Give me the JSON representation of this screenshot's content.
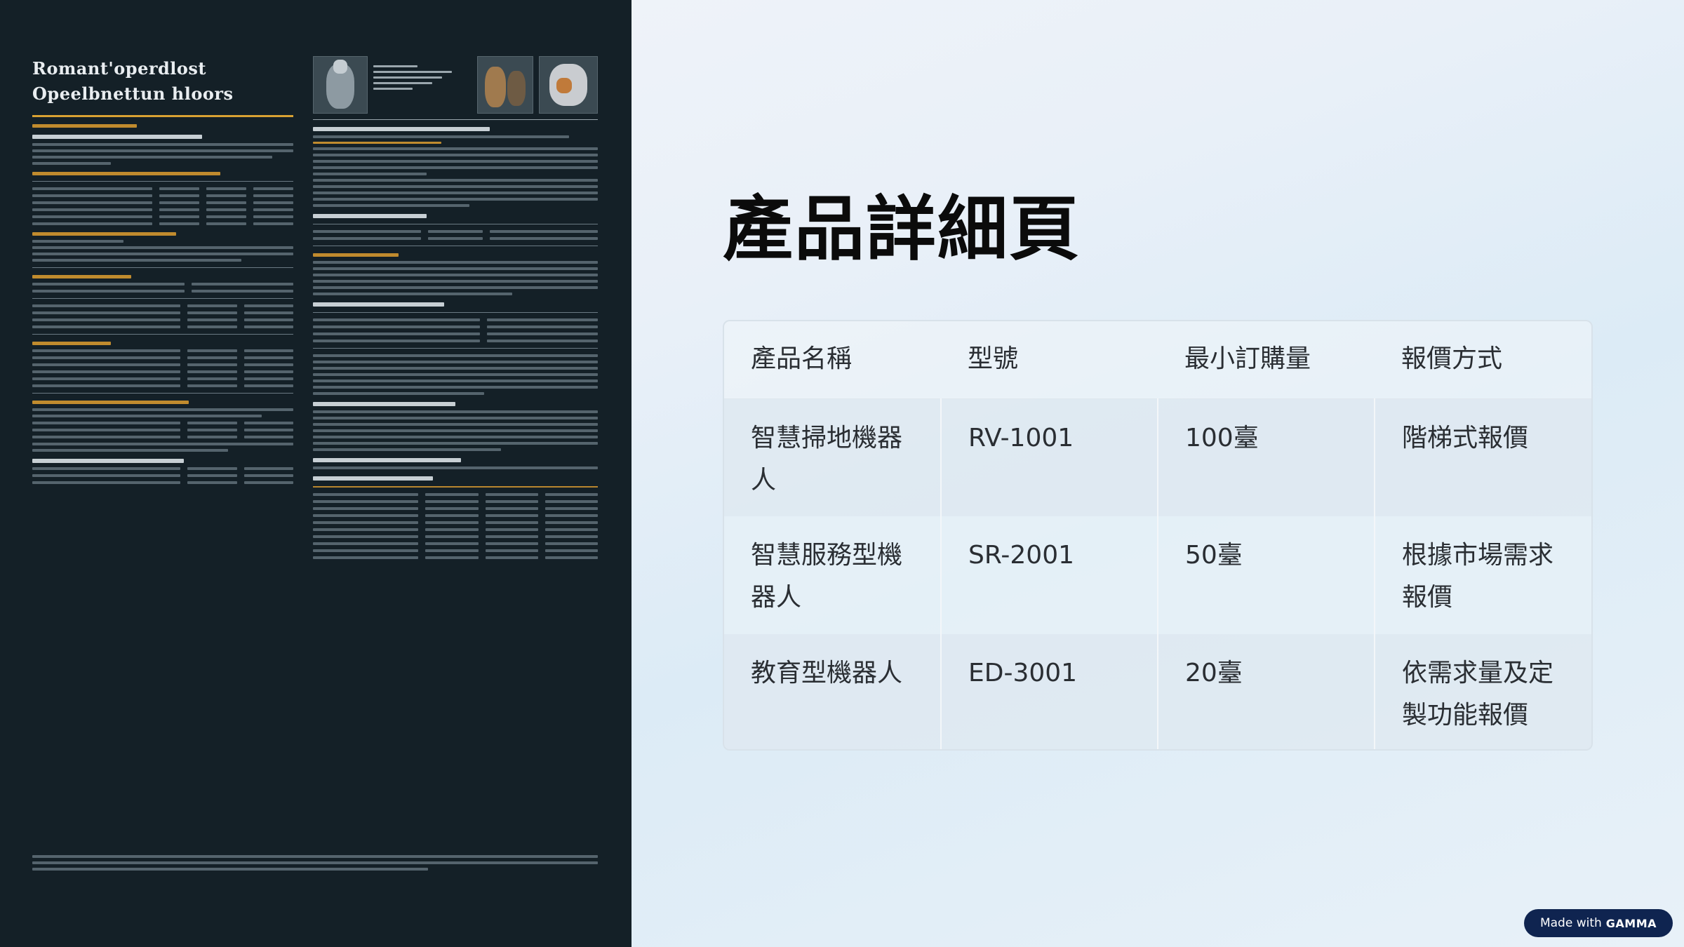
{
  "left_image": {
    "title_line1": "Romant'operdlost",
    "title_line2": "Opeelbnettun hloors"
  },
  "page": {
    "title": "產品詳細頁"
  },
  "table": {
    "headers": [
      "產品名稱",
      "型號",
      "最小訂購量",
      "報價方式"
    ],
    "rows": [
      [
        "智慧掃地機器人",
        "RV-1001",
        "100臺",
        "階梯式報價"
      ],
      [
        "智慧服務型機器人",
        "SR-2001",
        "50臺",
        "根據市場需求報價"
      ],
      [
        "教育型機器人",
        "ED-3001",
        "20臺",
        "依需求量及定製功能報價"
      ]
    ]
  },
  "badge": {
    "prefix": "Made with",
    "brand": "GAMMA"
  }
}
